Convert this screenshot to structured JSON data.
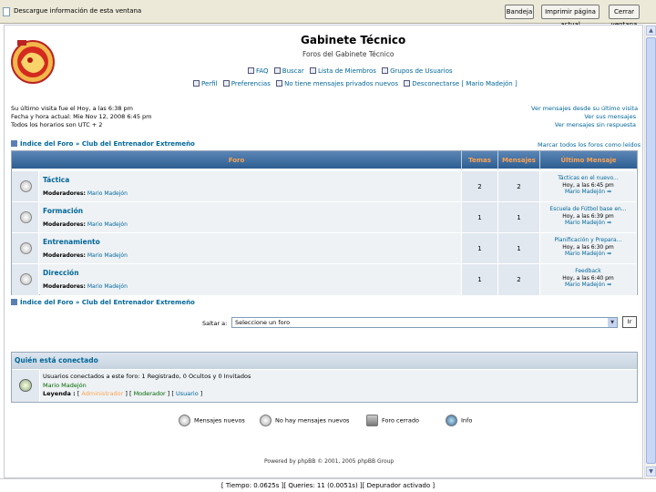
{
  "browser": {
    "status_text": "Descargue información de esta ventana",
    "btn_download": "Bandeja",
    "btn_print": "Imprimir página actual",
    "btn_close": "Cerrar ventana"
  },
  "header": {
    "title": "Gabinete Técnico",
    "description": "Foros del Gabinete Técnico",
    "nav_row1": [
      "FAQ",
      "Buscar",
      "Lista de Miembros",
      "Grupos de Usuarios"
    ],
    "nav_row2": [
      "Perfil",
      "Preferencias",
      "No tiene mensajes privados nuevos",
      "Desconectarse [ Mario Madejón ]"
    ]
  },
  "info_left": [
    "Su último visita fue el Hoy, a las 6:38 pm",
    "Fecha y hora actual: Mie Nov 12, 2008 6:45 pm",
    "Todos los horarios son UTC + 2"
  ],
  "info_right": [
    "Ver mensajes desde su último visita",
    "Ver sus mensajes",
    "Ver mensajes sin respuesta"
  ],
  "breadcrumb": "Índice del Foro » Club del Entrenador Extremeño",
  "mark_read": "Marcar todos los foros como leídos",
  "table": {
    "col_forum": "Foro",
    "col_topics": "Temas",
    "col_posts": "Mensajes",
    "col_last": "Último Mensaje",
    "moderators_label": "Moderadores:",
    "rows": [
      {
        "name": "Táctica",
        "moderator": "Mario Madejón",
        "topics": "2",
        "posts": "2",
        "last_title": "Tácticas en el nuevo...",
        "last_date": "Hoy, a las 6:45 pm",
        "last_user": "Mario Madejón"
      },
      {
        "name": "Formación",
        "moderator": "Mario Madejón",
        "topics": "1",
        "posts": "1",
        "last_title": "Escuela de Fútbol base en...",
        "last_date": "Hoy, a las 6:39 pm",
        "last_user": "Mario Madejón"
      },
      {
        "name": "Entrenamiento",
        "moderator": "Mario Madejón",
        "topics": "1",
        "posts": "1",
        "last_title": "Planificación y Prepara...",
        "last_date": "Hoy, a las 6:30 pm",
        "last_user": "Mario Madejón"
      },
      {
        "name": "Dirección",
        "moderator": "Mario Madejón",
        "topics": "1",
        "posts": "2",
        "last_title": "Feedback",
        "last_date": "Hoy, a las 6:40 pm",
        "last_user": "Mario Madejón"
      }
    ]
  },
  "jump": {
    "label": "Saltar a:",
    "selected": "Seleccione un foro",
    "button": "Ir"
  },
  "online": {
    "title": "Quién está conectado",
    "line1": "Usuarios conectados a este foro: 1 Registrado, 0 Ocultos y 0 Invitados",
    "user": "Mario Madejón",
    "legend_label": "Leyenda :",
    "legend_admin": "Administrador",
    "legend_mod": "Moderador",
    "legend_user": "Usuario"
  },
  "legend_icons": [
    "Mensajes nuevos",
    "No hay mensajes nuevos",
    "Foro cerrado",
    "Info"
  ],
  "powered": "Powered by phpBB © 2001, 2005 phpBB Group",
  "footer": "[ Tiempo: 0.0625s ][ Queries: 11 (0.0051s) ][ Depurador activado ]"
}
